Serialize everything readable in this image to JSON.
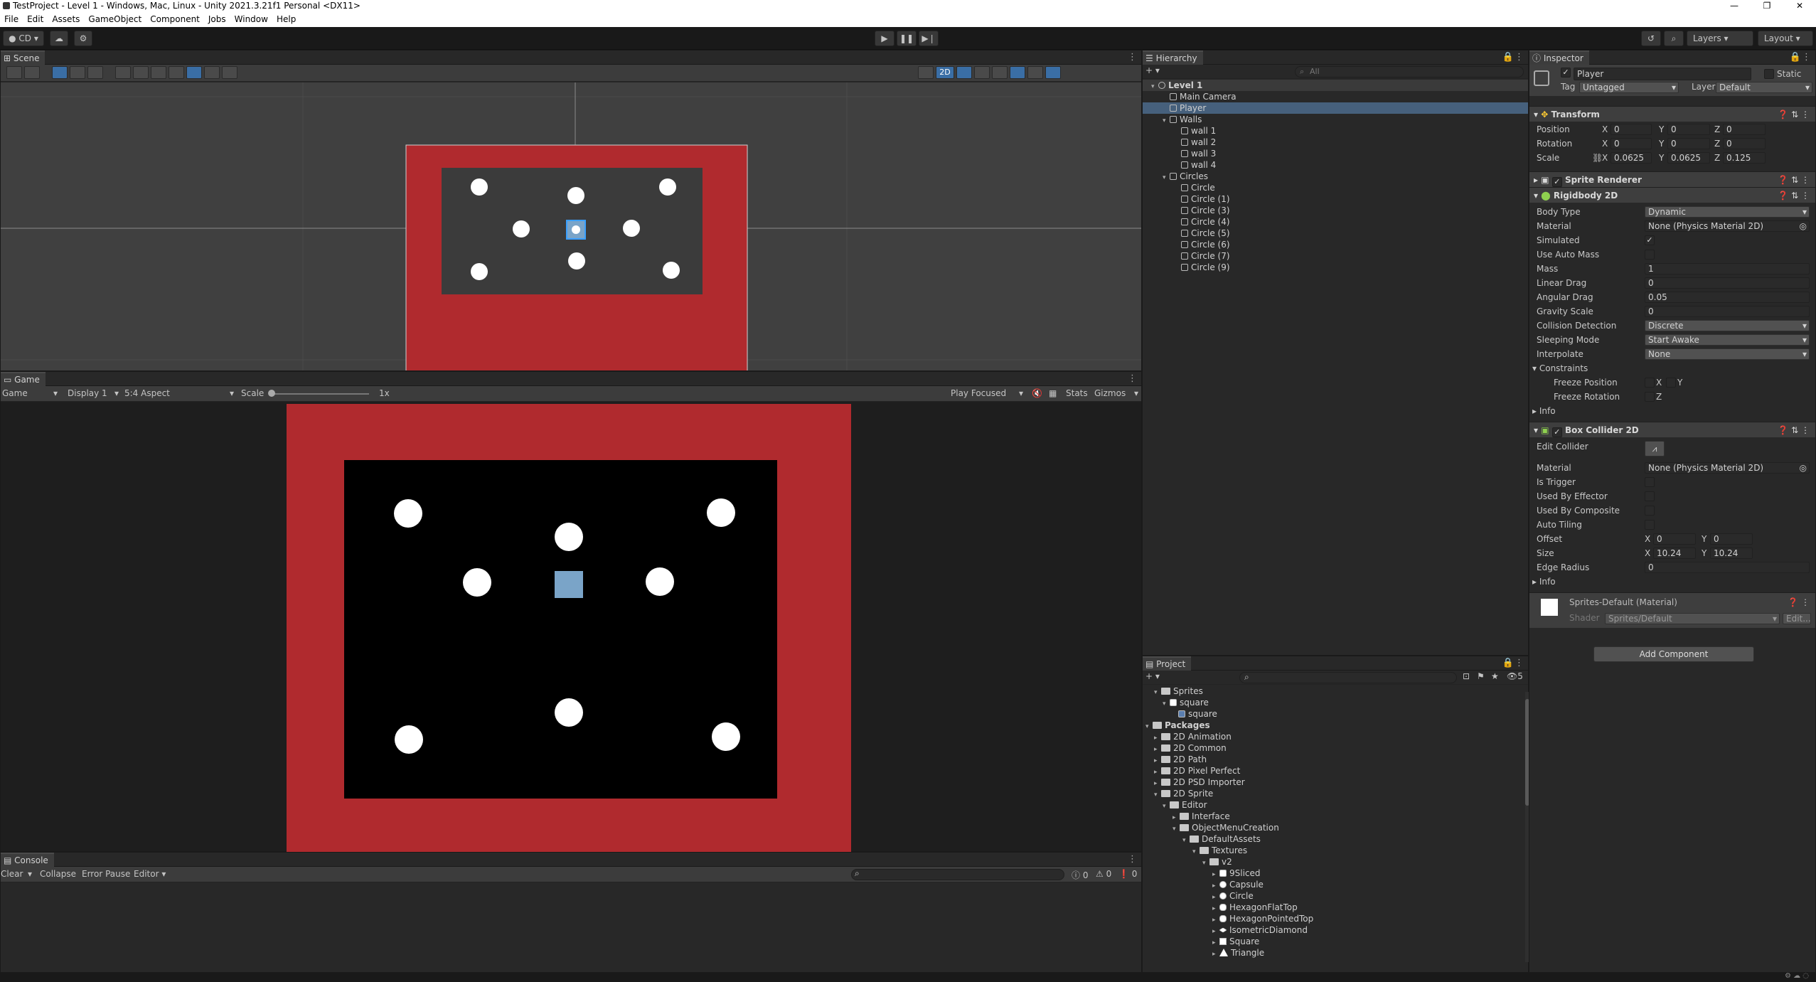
{
  "window": {
    "title": "TestProject - Level 1 - Windows, Mac, Linux - Unity 2021.3.21f1 Personal <DX11>"
  },
  "menu": [
    "File",
    "Edit",
    "Assets",
    "GameObject",
    "Component",
    "Jobs",
    "Window",
    "Help"
  ],
  "toolbar": {
    "account": "CD",
    "layers": "Layers",
    "layout": "Layout"
  },
  "scene": {
    "tab": "Scene",
    "mode_2d": "2D"
  },
  "game": {
    "tab": "Game",
    "game_dropdown": "Game",
    "display": "Display 1",
    "aspect": "5:4 Aspect",
    "scale_label": "Scale",
    "scale_value": "1x",
    "play_focused": "Play Focused",
    "stats": "Stats",
    "gizmos": "Gizmos"
  },
  "console": {
    "tab": "Console",
    "clear": "Clear",
    "collapse": "Collapse",
    "error_pause": "Error Pause",
    "editor": "Editor",
    "count_log": "0",
    "count_warn": "0",
    "count_error": "0"
  },
  "hierarchy": {
    "tab": "Hierarchy",
    "search_placeholder": "All",
    "items": [
      {
        "label": "Level 1"
      },
      {
        "label": "Main Camera"
      },
      {
        "label": "Player"
      },
      {
        "label": "Walls"
      },
      {
        "label": "wall 1"
      },
      {
        "label": "wall 2"
      },
      {
        "label": "wall 3"
      },
      {
        "label": "wall 4"
      },
      {
        "label": "Circles"
      },
      {
        "label": "Circle"
      },
      {
        "label": "Circle (1)"
      },
      {
        "label": "Circle (3)"
      },
      {
        "label": "Circle (4)"
      },
      {
        "label": "Circle (5)"
      },
      {
        "label": "Circle (6)"
      },
      {
        "label": "Circle (7)"
      },
      {
        "label": "Circle (9)"
      }
    ]
  },
  "project": {
    "tab": "Project",
    "hidden_count": "5",
    "items": [
      {
        "label": "Sprites"
      },
      {
        "label": "square"
      },
      {
        "label": "square"
      },
      {
        "label": "Packages"
      },
      {
        "label": "2D Animation"
      },
      {
        "label": "2D Common"
      },
      {
        "label": "2D Path"
      },
      {
        "label": "2D Pixel Perfect"
      },
      {
        "label": "2D PSD Importer"
      },
      {
        "label": "2D Sprite"
      },
      {
        "label": "Editor"
      },
      {
        "label": "Interface"
      },
      {
        "label": "ObjectMenuCreation"
      },
      {
        "label": "DefaultAssets"
      },
      {
        "label": "Textures"
      },
      {
        "label": "v2"
      },
      {
        "label": "9Sliced"
      },
      {
        "label": "Capsule"
      },
      {
        "label": "Circle"
      },
      {
        "label": "HexagonFlatTop"
      },
      {
        "label": "HexagonPointedTop"
      },
      {
        "label": "IsometricDiamond"
      },
      {
        "label": "Square"
      },
      {
        "label": "Triangle"
      }
    ]
  },
  "inspector": {
    "tab": "Inspector",
    "object_name": "Player",
    "static": "Static",
    "tag_label": "Tag",
    "tag": "Untagged",
    "layer_label": "Layer",
    "layer": "Default",
    "transform": {
      "title": "Transform",
      "position_label": "Position",
      "pos": [
        "0",
        "0",
        "0"
      ],
      "rotation_label": "Rotation",
      "rot": [
        "0",
        "0",
        "0"
      ],
      "scale_label": "Scale",
      "scale": [
        "0.0625",
        "0.0625",
        "0.125"
      ],
      "x": "X",
      "y": "Y",
      "z": "Z"
    },
    "sprite_renderer": {
      "title": "Sprite Renderer"
    },
    "rigidbody": {
      "title": "Rigidbody 2D",
      "body_type_label": "Body Type",
      "body_type": "Dynamic",
      "material_label": "Material",
      "material": "None (Physics Material 2D)",
      "simulated_label": "Simulated",
      "use_auto_mass_label": "Use Auto Mass",
      "mass_label": "Mass",
      "mass": "1",
      "linear_drag_label": "Linear Drag",
      "linear_drag": "0",
      "angular_drag_label": "Angular Drag",
      "angular_drag": "0.05",
      "gravity_scale_label": "Gravity Scale",
      "gravity_scale": "0",
      "collision_label": "Collision Detection",
      "collision": "Discrete",
      "sleeping_label": "Sleeping Mode",
      "sleeping": "Start Awake",
      "interpolate_label": "Interpolate",
      "interpolate": "None",
      "constraints_label": "Constraints",
      "freeze_pos_label": "Freeze Position",
      "freeze_rot_label": "Freeze Rotation",
      "info_label": "Info"
    },
    "box_collider": {
      "title": "Box Collider 2D",
      "edit_collider_label": "Edit Collider",
      "material_label": "Material",
      "material": "None (Physics Material 2D)",
      "is_trigger_label": "Is Trigger",
      "used_by_effector_label": "Used By Effector",
      "used_by_composite_label": "Used By Composite",
      "auto_tiling_label": "Auto Tiling",
      "offset_label": "Offset",
      "offset": [
        "0",
        "0"
      ],
      "size_label": "Size",
      "size": [
        "10.24",
        "10.24"
      ],
      "edge_radius_label": "Edge Radius",
      "edge_radius": "0",
      "info_label": "Info"
    },
    "material": {
      "name": "Sprites-Default (Material)",
      "shader_label": "Shader",
      "shader": "Sprites/Default",
      "edit": "Edit..."
    },
    "add_component": "Add Component"
  },
  "colors": {
    "wall_red": "#b02a2e",
    "player_blue": "#7aa4c8",
    "selection": "#2c5d87"
  }
}
